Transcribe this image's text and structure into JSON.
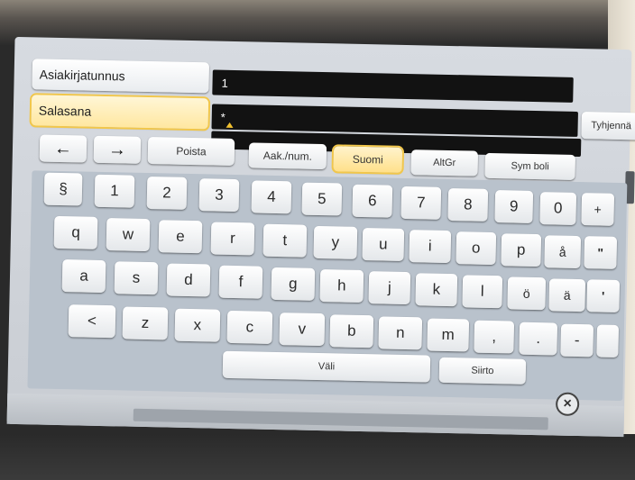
{
  "fields": {
    "id_label": "Asiakirjatunnus",
    "id_value": "1",
    "password_label": "Salasana",
    "password_value": "*",
    "clear_label": "Tyhjennä"
  },
  "toolbar": {
    "left_arrow": "←",
    "right_arrow": "→",
    "delete": "Poista",
    "mode": "Aak./num.",
    "language": "Suomi",
    "altgr": "AltGr",
    "symbols": "Sym boli"
  },
  "keyboard": {
    "row1": [
      "§",
      "1",
      "2",
      "3",
      "4",
      "5",
      "6",
      "7",
      "8",
      "9",
      "0",
      "+",
      "´"
    ],
    "row2": [
      "q",
      "w",
      "e",
      "r",
      "t",
      "y",
      "u",
      "i",
      "o",
      "p",
      "å",
      "\""
    ],
    "row3": [
      "a",
      "s",
      "d",
      "f",
      "g",
      "h",
      "j",
      "k",
      "l",
      "ö",
      "ä",
      "'"
    ],
    "row4": [
      "<",
      "z",
      "x",
      "c",
      "v",
      "b",
      "n",
      "m",
      ",",
      ".",
      "-",
      ""
    ],
    "space": "Väli",
    "shift": "Siirto"
  },
  "close_icon": "×"
}
